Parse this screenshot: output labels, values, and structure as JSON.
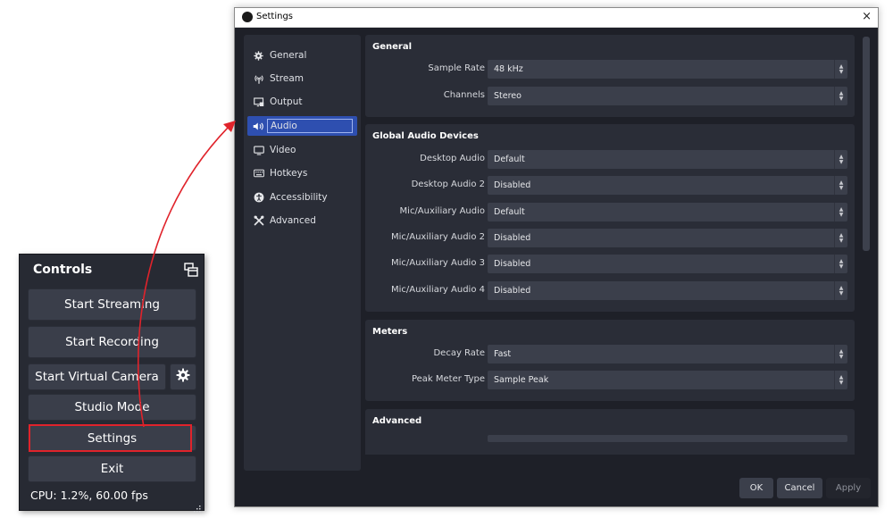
{
  "controls_dock": {
    "title": "Controls",
    "buttons": {
      "start_streaming": "Start Streaming",
      "start_recording": "Start Recording",
      "start_virtual_camera": "Start Virtual Camera",
      "studio_mode": "Studio Mode",
      "settings": "Settings",
      "exit": "Exit"
    },
    "status": "CPU: 1.2%, 60.00 fps"
  },
  "settings_window": {
    "title": "Settings",
    "close_glyph": "×",
    "nav": [
      {
        "label": "General",
        "icon": "gear-icon"
      },
      {
        "label": "Stream",
        "icon": "antenna-icon"
      },
      {
        "label": "Output",
        "icon": "monitor-output-icon"
      },
      {
        "label": "Audio",
        "icon": "speaker-icon",
        "active": true
      },
      {
        "label": "Video",
        "icon": "display-icon"
      },
      {
        "label": "Hotkeys",
        "icon": "keyboard-icon"
      },
      {
        "label": "Accessibility",
        "icon": "accessibility-icon"
      },
      {
        "label": "Advanced",
        "icon": "tools-icon"
      }
    ],
    "sections": {
      "general": {
        "title": "General",
        "sample_rate": {
          "label": "Sample Rate",
          "value": "48 kHz"
        },
        "channels": {
          "label": "Channels",
          "value": "Stereo"
        }
      },
      "global_audio_devices": {
        "title": "Global Audio Devices",
        "desktop_audio": {
          "label": "Desktop Audio",
          "value": "Default"
        },
        "desktop_audio_2": {
          "label": "Desktop Audio 2",
          "value": "Disabled"
        },
        "mic_aux_audio": {
          "label": "Mic/Auxiliary Audio",
          "value": "Default"
        },
        "mic_aux_audio_2": {
          "label": "Mic/Auxiliary Audio 2",
          "value": "Disabled"
        },
        "mic_aux_audio_3": {
          "label": "Mic/Auxiliary Audio 3",
          "value": "Disabled"
        },
        "mic_aux_audio_4": {
          "label": "Mic/Auxiliary Audio 4",
          "value": "Disabled"
        }
      },
      "meters": {
        "title": "Meters",
        "decay_rate": {
          "label": "Decay Rate",
          "value": "Fast"
        },
        "peak_meter_type": {
          "label": "Peak Meter Type",
          "value": "Sample Peak"
        }
      },
      "advanced": {
        "title": "Advanced"
      }
    },
    "footer": {
      "ok": "OK",
      "cancel": "Cancel",
      "apply": "Apply"
    }
  },
  "colors": {
    "highlight_red": "#e0232b",
    "active_nav_blue": "#2e4fb0",
    "panel_bg": "#2a2d37",
    "window_bg": "#1e2028"
  }
}
